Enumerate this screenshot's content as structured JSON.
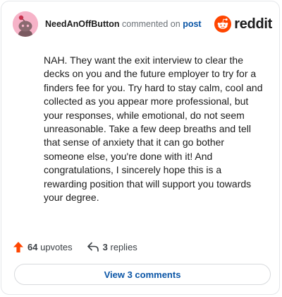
{
  "comment": {
    "author": "NeedAnOffButton",
    "action_text": "commented on",
    "post_link_text": "post",
    "body": "NAH. They want the exit interview to clear the decks on you and the future employer to try for a finders fee for you. Try hard to stay calm, cool and collected as you appear more professional, but your responses, while emotional, do not seem unreasonable. Take a few deep breaths and tell that sense of anxiety that it can go bother someone else, you're done with it! And congratulations, I sincerely hope this is a rewarding position that will support you towards your degree."
  },
  "brand": {
    "name": "reddit",
    "icon": "reddit-snoo-icon",
    "color": "#ff4500"
  },
  "stats": {
    "upvotes_count": "64",
    "upvotes_label": "upvotes",
    "upvote_icon": "upvote-arrow-icon",
    "upvote_color": "#ff4500",
    "replies_count": "3",
    "replies_label": "replies",
    "reply_icon": "reply-arrow-icon"
  },
  "actions": {
    "view_comments_label": "View 3 comments"
  },
  "colors": {
    "link": "#0a55a6",
    "avatar_bg": "#f6b3c8"
  }
}
